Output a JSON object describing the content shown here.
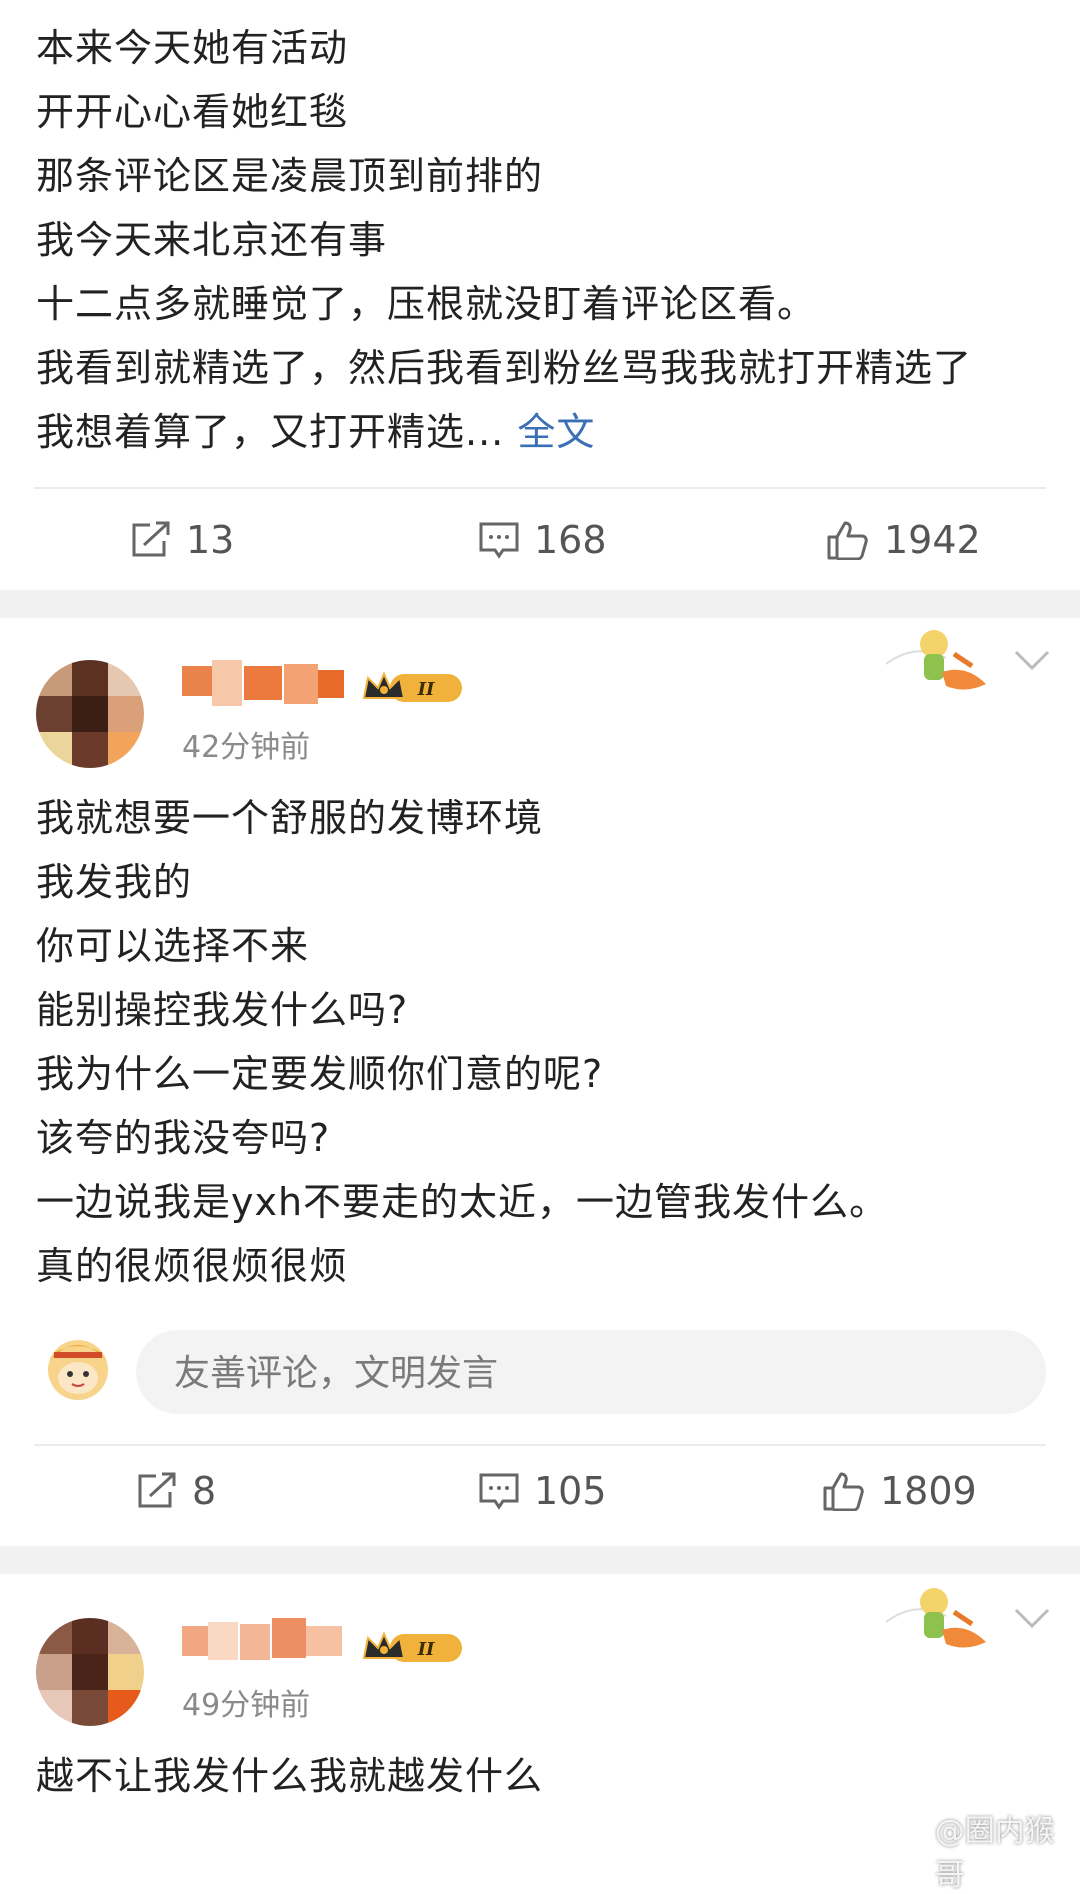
{
  "post1": {
    "lines": [
      "本来今天她有活动",
      "开开心心看她红毯",
      "那条评论区是凌晨顶到前排的",
      "我今天来北京还有事",
      "十二点多就睡觉了，压根就没盯着评论区看。",
      "我看到就精选了，然后我看到粉丝骂我我就打开精选了",
      "我想着算了，又打开精选..."
    ],
    "more_label": "全文",
    "reposts": "13",
    "comments": "168",
    "likes": "1942"
  },
  "post2": {
    "time": "42分钟前",
    "lines": [
      "我就想要一个舒服的发博环境",
      "我发我的",
      "你可以选择不来",
      "能别操控我发什么吗?",
      "我为什么一定要发顺你们意的呢?",
      "该夸的我没夸吗?",
      "一边说我是yxh不要走的太近，一边管我发什么。",
      "真的很烦很烦很烦"
    ],
    "comment_placeholder": "友善评论，文明发言",
    "reposts": "8",
    "comments": "105",
    "likes": "1809"
  },
  "post3": {
    "time": "49分钟前",
    "lines": [
      "越不让我发什么我就越发什么"
    ]
  },
  "badge_level": "II",
  "watermark": "@圈内猴哥",
  "colors": {
    "link": "#3a6fb5",
    "separator": "#f1f1f1",
    "badge": "#f0b23a"
  }
}
